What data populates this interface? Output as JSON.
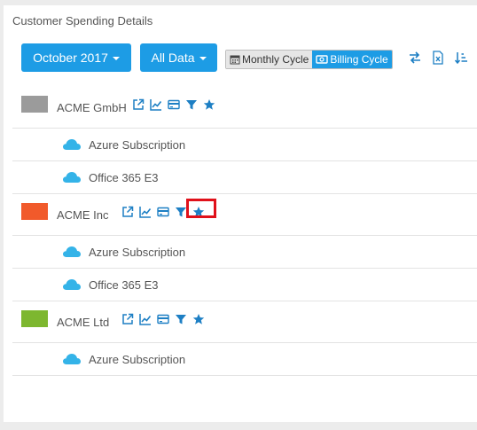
{
  "panel": {
    "title": "Customer Spending Details"
  },
  "toolbar": {
    "period_label": "October 2017",
    "filter_label": "All Data",
    "monthly_cycle_label": "Monthly Cycle",
    "billing_cycle_label": "Billing Cycle",
    "active_cycle": "billing"
  },
  "colors": {
    "accent": "#1d9ce5",
    "highlight": "#e0111a"
  },
  "customers": [
    {
      "name": "ACME GmbH",
      "color": "#9b9b9b",
      "subscriptions": [
        {
          "name": "Azure Subscription",
          "icon": "azure-cloud-icon"
        },
        {
          "name": "Office 365 E3",
          "icon": "azure-cloud-icon"
        }
      ]
    },
    {
      "name": "ACME Inc",
      "color": "#f15a2b",
      "subscriptions": [
        {
          "name": "Azure Subscription",
          "icon": "azure-cloud-icon"
        },
        {
          "name": "Office 365 E3",
          "icon": "azure-cloud-icon"
        }
      ]
    },
    {
      "name": "ACME Ltd",
      "color": "#7db72f",
      "subscriptions": [
        {
          "name": "Azure Subscription",
          "icon": "azure-cloud-icon"
        }
      ]
    }
  ]
}
